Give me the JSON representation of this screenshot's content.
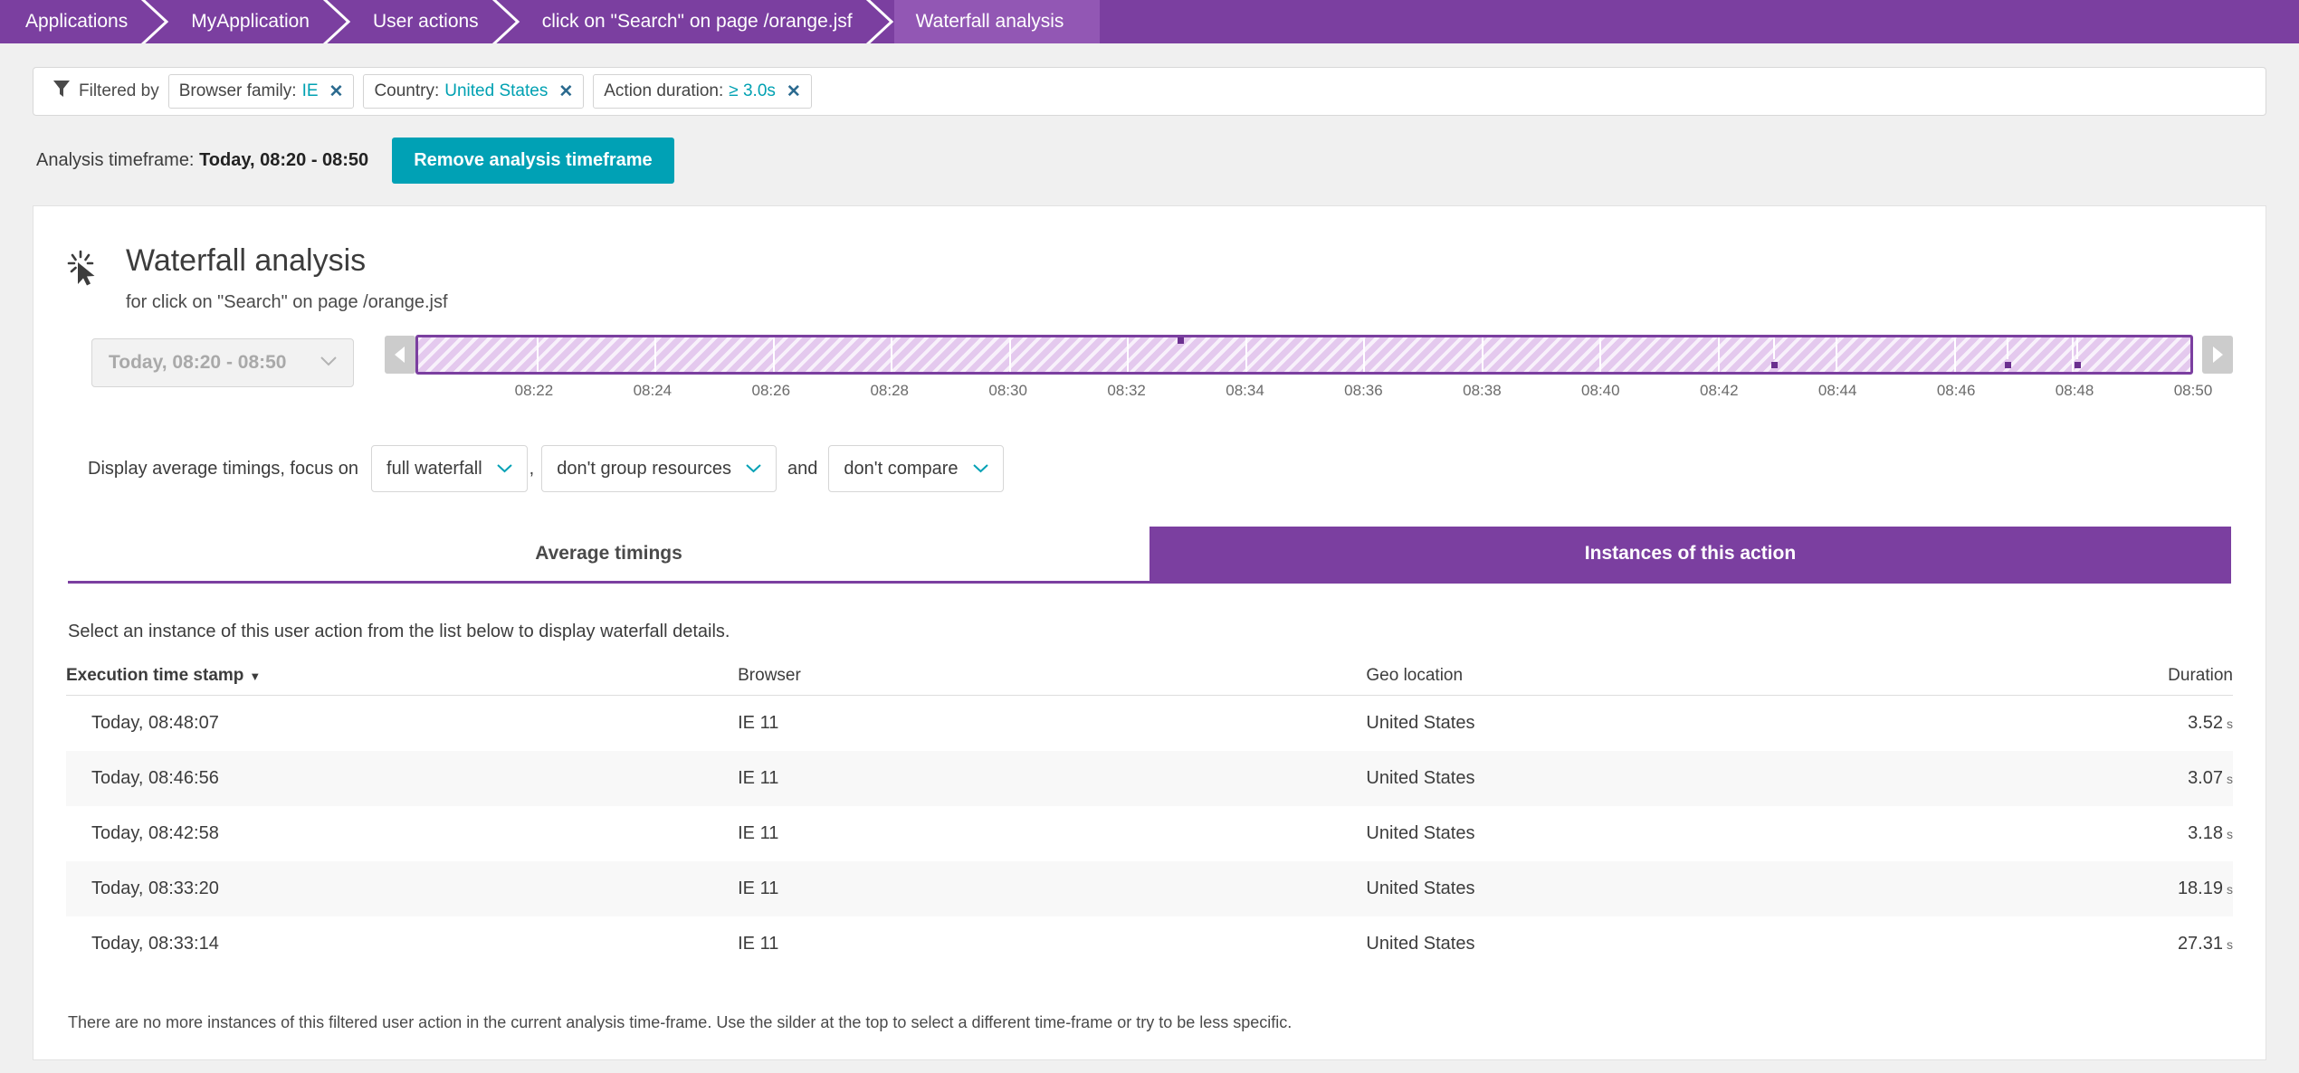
{
  "breadcrumb": {
    "items": [
      {
        "label": "Applications",
        "active": false
      },
      {
        "label": "MyApplication",
        "active": false
      },
      {
        "label": "User actions",
        "active": false
      },
      {
        "label": "click on \"Search\" on page /orange.jsf",
        "active": false
      },
      {
        "label": "Waterfall analysis",
        "active": true
      }
    ]
  },
  "filter_bar": {
    "icon": "funnel-icon",
    "label": "Filtered by",
    "chips": [
      {
        "name": "Browser family:",
        "value": "IE",
        "close": "✕"
      },
      {
        "name": "Country:",
        "value": "United States",
        "close": "✕"
      },
      {
        "name": "Action duration:",
        "value": "≥ 3.0s",
        "close": "✕"
      }
    ]
  },
  "timeframe": {
    "label": "Analysis timeframe:",
    "value": "Today, 08:20 - 08:50",
    "remove_button": "Remove analysis timeframe"
  },
  "card": {
    "icon": "click-cursor-icon",
    "title": "Waterfall analysis",
    "subtitle": "for click on \"Search\" on page /orange.jsf",
    "timeframe_select": {
      "value": "Today, 08:20 - 08:50",
      "caret": "⌄"
    },
    "slider": {
      "prev_arrow": "◀",
      "next_arrow": "▶",
      "range_start": "08:20",
      "range_end": "08:50",
      "ticks": [
        "08:22",
        "08:24",
        "08:26",
        "08:28",
        "08:30",
        "08:32",
        "08:34",
        "08:36",
        "08:38",
        "08:40",
        "08:42",
        "08:44",
        "08:46",
        "08:48",
        "08:50"
      ],
      "markers": [
        {
          "time": "08:33",
          "pct": 43.0,
          "top": true
        },
        {
          "time": "08:42:58",
          "pct": 76.5,
          "top": false
        },
        {
          "time": "08:46:56",
          "pct": 89.7,
          "top": false
        },
        {
          "time": "08:48:07",
          "pct": 93.6,
          "top": false
        }
      ]
    },
    "controls": {
      "lead": "Display average timings, focus on",
      "focus": {
        "value": "full waterfall",
        "caret": "⌄"
      },
      "comma": ",",
      "grouping": {
        "value": "don't group resources",
        "caret": "⌄"
      },
      "and": "and",
      "compare": {
        "value": "don't compare",
        "caret": "⌄"
      }
    },
    "tabs": [
      {
        "label": "Average timings",
        "active": false
      },
      {
        "label": "Instances of this action",
        "active": true
      }
    ],
    "instances": {
      "hint": "Select an instance of this user action from the list below to display waterfall details.",
      "columns": [
        {
          "label": "Execution time stamp",
          "sorted": true,
          "caret": "▼",
          "align": "left"
        },
        {
          "label": "Browser",
          "sorted": false,
          "caret": "",
          "align": "left"
        },
        {
          "label": "Geo location",
          "sorted": false,
          "caret": "",
          "align": "left"
        },
        {
          "label": "Duration",
          "sorted": false,
          "caret": "",
          "align": "right"
        }
      ],
      "rows": [
        {
          "timestamp": "Today, 08:48:07",
          "browser": "IE 11",
          "geo": "United States",
          "duration": "3.52",
          "unit": "s"
        },
        {
          "timestamp": "Today, 08:46:56",
          "browser": "IE 11",
          "geo": "United States",
          "duration": "3.07",
          "unit": "s"
        },
        {
          "timestamp": "Today, 08:42:58",
          "browser": "IE 11",
          "geo": "United States",
          "duration": "3.18",
          "unit": "s"
        },
        {
          "timestamp": "Today, 08:33:20",
          "browser": "IE 11",
          "geo": "United States",
          "duration": "18.19",
          "unit": "s"
        },
        {
          "timestamp": "Today, 08:33:14",
          "browser": "IE 11",
          "geo": "United States",
          "duration": "27.31",
          "unit": "s"
        }
      ],
      "footnote": "There are no more instances of this filtered user action in the current analysis time-frame. Use the silder at the top to select a different time-frame or try to be less specific."
    }
  },
  "colors": {
    "brand_purple": "#7b3fa0",
    "brand_purple_light": "#9257b4",
    "teal": "#00a1b5",
    "link_teal": "#00a1b2",
    "slider_fill": "#e4c9ee"
  }
}
